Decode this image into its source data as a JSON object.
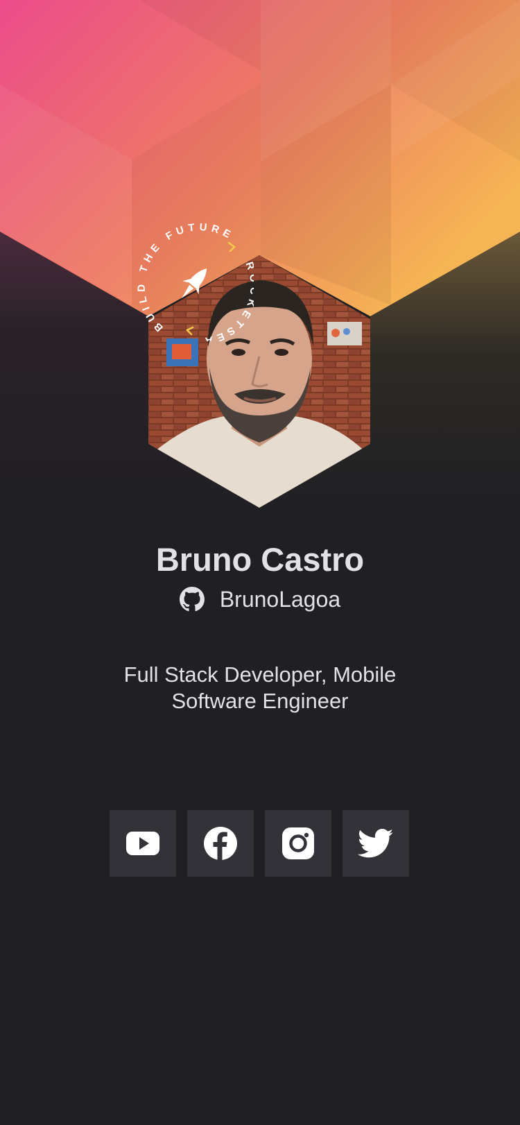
{
  "badge": {
    "top_text": "BUILD THE FUTURE",
    "side_text": "ROCKETSEAT"
  },
  "profile": {
    "name": "Bruno Castro",
    "username": "BrunoLagoa",
    "bio": "Full Stack Developer, Mobile Software Engineer"
  },
  "socials": [
    {
      "label": "YouTube",
      "icon": "youtube-icon"
    },
    {
      "label": "Facebook",
      "icon": "facebook-icon"
    },
    {
      "label": "Instagram",
      "icon": "instagram-icon"
    },
    {
      "label": "Twitter",
      "icon": "twitter-icon"
    }
  ],
  "colors": {
    "background": "#202024",
    "tile": "#323238",
    "text": "#e1e1e6",
    "gradient_start": "#ec4c8b",
    "gradient_end": "#f6b554",
    "accent": "#f7c948"
  }
}
